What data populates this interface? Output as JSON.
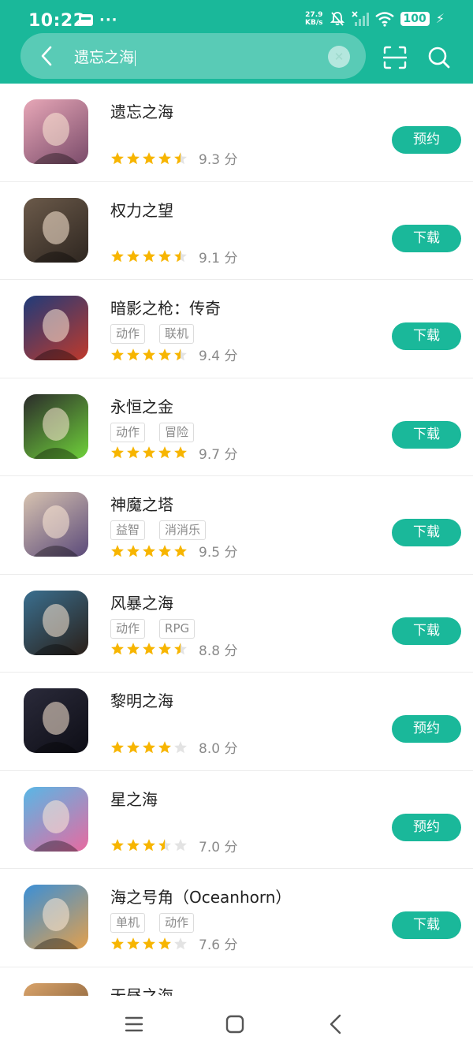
{
  "status_bar": {
    "time": "10:22",
    "dots": "···",
    "net_speed_value": "27.9",
    "net_speed_unit": "KB/s",
    "battery": "100"
  },
  "search": {
    "query": "遗忘之海",
    "clear_icon": "close-icon"
  },
  "colors": {
    "accent": "#1ab89a",
    "star_filled": "#f7b500",
    "star_empty": "#e3e3e3"
  },
  "apps": [
    {
      "name": "遗忘之海",
      "tags": [],
      "rating": 4.5,
      "score": "9.3 分",
      "action": "预约"
    },
    {
      "name": "权力之望",
      "tags": [],
      "rating": 4.5,
      "score": "9.1 分",
      "action": "下载"
    },
    {
      "name": "暗影之枪：传奇",
      "tags": [
        "动作",
        "联机"
      ],
      "rating": 4.5,
      "score": "9.4 分",
      "action": "下载"
    },
    {
      "name": "永恒之金",
      "tags": [
        "动作",
        "冒险"
      ],
      "rating": 5,
      "score": "9.7 分",
      "action": "下载"
    },
    {
      "name": "神魔之塔",
      "tags": [
        "益智",
        "消消乐"
      ],
      "rating": 5,
      "score": "9.5 分",
      "action": "下载"
    },
    {
      "name": "风暴之海",
      "tags": [
        "动作",
        "RPG"
      ],
      "rating": 4.5,
      "score": "8.8 分",
      "action": "下载"
    },
    {
      "name": " 黎明之海",
      "tags": [],
      "rating": 4,
      "score": "8.0 分",
      "action": "预约"
    },
    {
      "name": "星之海",
      "tags": [],
      "rating": 3.5,
      "score": "7.0 分",
      "action": "预约"
    },
    {
      "name": "海之号角（Oceanhorn）",
      "tags": [
        "单机",
        "动作"
      ],
      "rating": 4,
      "score": "7.6 分",
      "action": "下载"
    },
    {
      "name": "无昼之海",
      "tags": [],
      "rating": 0,
      "score": "",
      "action": ""
    }
  ]
}
